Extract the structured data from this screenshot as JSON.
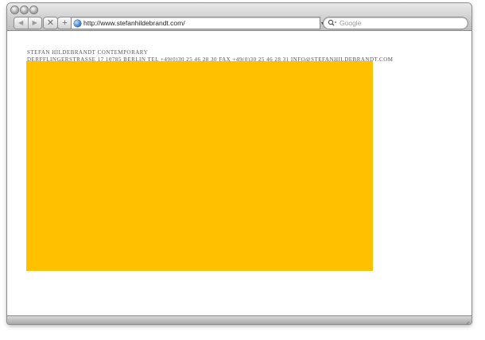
{
  "browser": {
    "url": "http://www.stefanhildebrandt.com/",
    "search_placeholder": "Google",
    "icons": {
      "window_controls": [
        "close-icon",
        "minimize-icon",
        "zoom-icon"
      ],
      "back": "back-arrow-icon",
      "forward": "forward-arrow-icon",
      "stop": "stop-icon",
      "add_bookmark": "plus-icon",
      "site": "globe-icon",
      "search": "search-icon",
      "resize": "resize-grip-icon"
    },
    "glyphs": {
      "back": "◀",
      "forward": "▶",
      "stop": "✕",
      "add": "+",
      "dropdown": "▾"
    }
  },
  "page": {
    "gallery_name": "STEFAN HILDEBRANDT CONTEMPORARY",
    "contact_line": "DERFFLINGERSTRASSE 17 10785 BERLIN TEL +49(0)30 25 46 28 30 FAX +49(0)30 25 46 28 31 INFO@STEFANHILDEBRANDT.COM",
    "banner_color": "#FFC000"
  }
}
